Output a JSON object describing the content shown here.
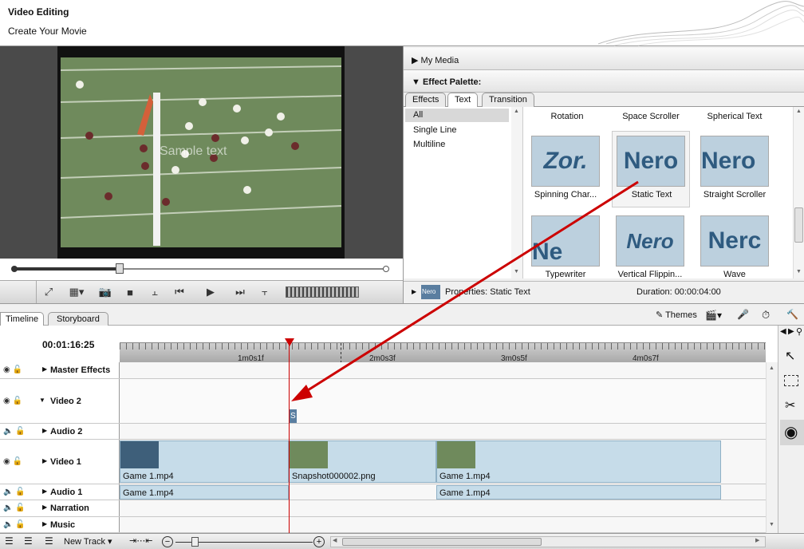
{
  "header": {
    "title": "Video Editing",
    "subtitle": "Create Your Movie"
  },
  "preview": {
    "overlay_text": "Sample text",
    "progress_fraction": 0.28
  },
  "my_media": {
    "label": "My Media"
  },
  "effect_palette": {
    "label": "Effect Palette:",
    "tabs": [
      "Effects",
      "Text",
      "Transition"
    ],
    "active_tab": "Text",
    "categories": [
      "All",
      "Single Line",
      "Multiline"
    ],
    "selected_category": "All",
    "top_row_labels": [
      "Rotation",
      "Space Scroller",
      "Spherical Text"
    ],
    "items": [
      {
        "label": "Spinning Char...",
        "glyph": "Zor."
      },
      {
        "label": "Static Text",
        "glyph": "Nero"
      },
      {
        "label": "Straight Scroller",
        "glyph": "Nero"
      },
      {
        "label": "Typewriter",
        "glyph": "Ne"
      },
      {
        "label": "Vertical Flippin...",
        "glyph": "Nero"
      },
      {
        "label": "Wave",
        "glyph": "Nerc"
      }
    ],
    "selected_item": "Static Text"
  },
  "properties": {
    "logo": "Nero",
    "label": "Properties: Static Text",
    "duration": "Duration: 00:00:04:00"
  },
  "timeline": {
    "tabs": [
      "Timeline",
      "Storyboard"
    ],
    "active_tab": "Timeline",
    "themes_label": "Themes",
    "timecode": "00:01:16:25",
    "ruler_labels": [
      "1m0s1f",
      "2m0s3f",
      "3m0s5f",
      "4m0s7f"
    ],
    "tracks": [
      "Master Effects",
      "Video 2",
      "Audio 2",
      "Video 1",
      "Audio 1",
      "Narration",
      "Music"
    ],
    "video2_clip": "S",
    "video1_clips": [
      "Game 1.mp4",
      "Snapshot000002.png",
      "Game 1.mp4"
    ],
    "audio1_clips": [
      "Game 1.mp4",
      "Game 1.mp4"
    ]
  },
  "bottom": {
    "new_track": "New Track"
  },
  "colors": {
    "accent_red": "#cc0000",
    "clip_blue": "#c6dce9"
  }
}
